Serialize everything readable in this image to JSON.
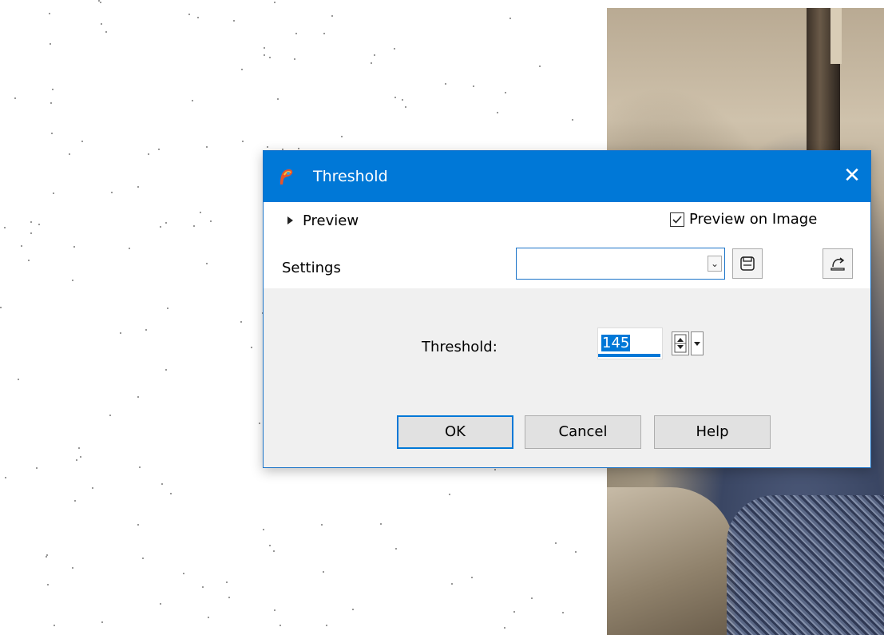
{
  "dialog": {
    "title": "Threshold",
    "close_glyph": "✕",
    "app_icon": "paintshop-pro-icon"
  },
  "preview": {
    "toggle_label": "Preview",
    "preview_on_image_label": "Preview on Image",
    "preview_on_image_checked": true
  },
  "settings": {
    "label": "Settings",
    "selected": "",
    "save_icon": "save-preset-icon",
    "reset_icon": "reset-to-default-icon"
  },
  "threshold": {
    "label": "Threshold:",
    "value": "145"
  },
  "buttons": {
    "ok": "OK",
    "cancel": "Cancel",
    "help": "Help"
  },
  "colors": {
    "title_bar": "#0078d7",
    "accent": "#0078d7"
  }
}
